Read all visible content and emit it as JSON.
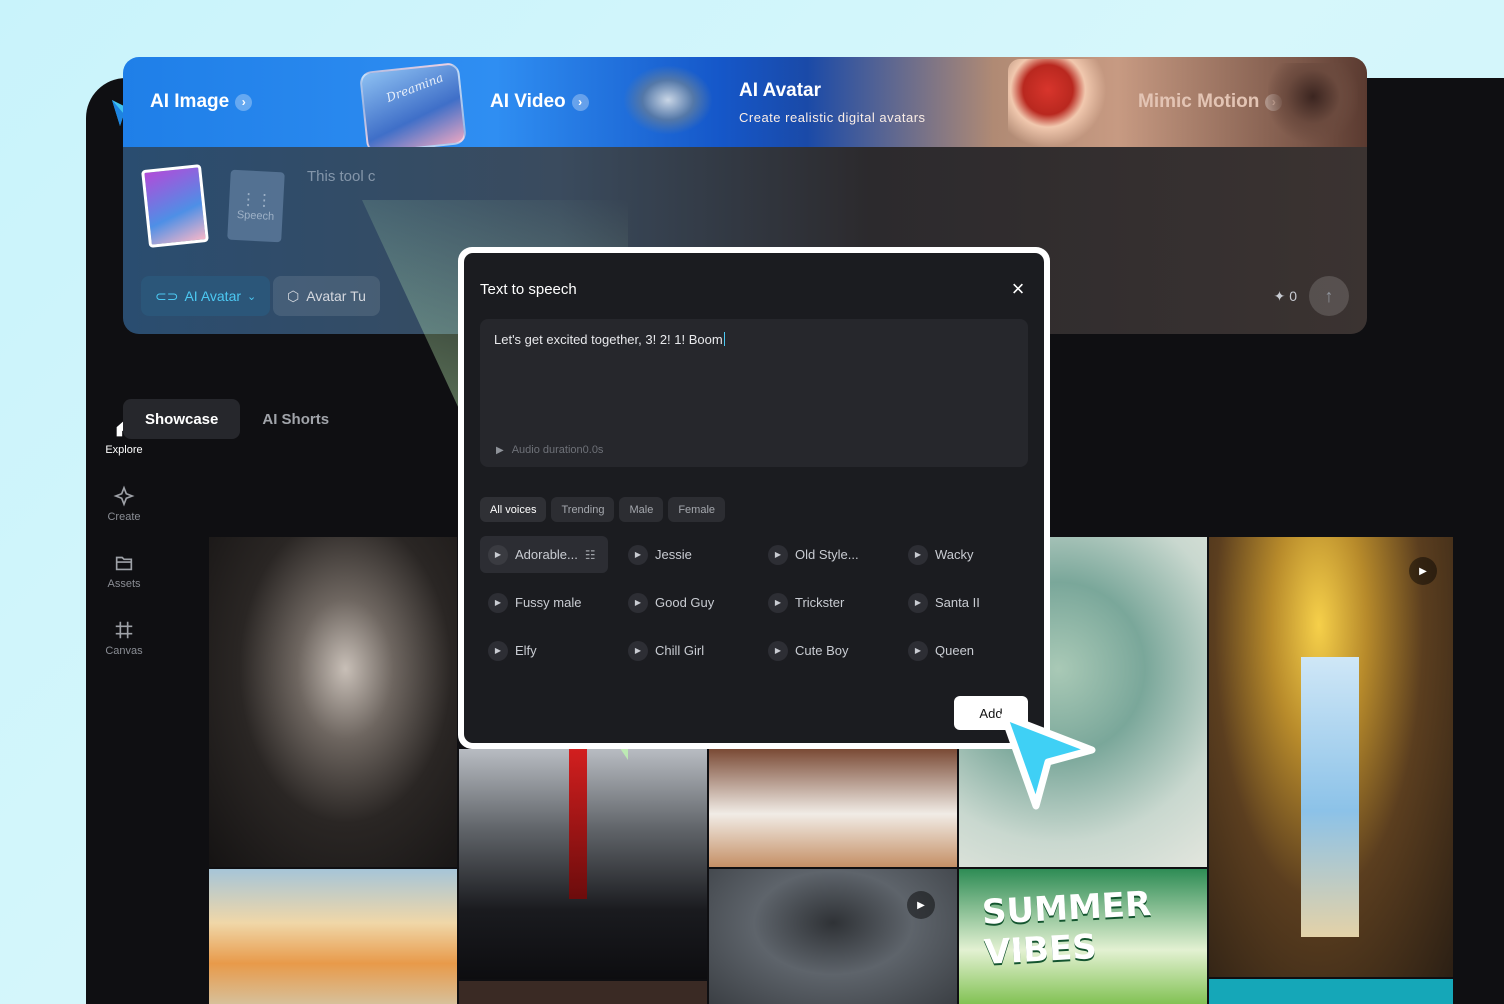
{
  "sidebar": {
    "items": [
      {
        "label": "Explore",
        "icon": "home-icon",
        "active": true
      },
      {
        "label": "Create",
        "icon": "sparkle-icon",
        "active": false
      },
      {
        "label": "Assets",
        "icon": "folder-icon",
        "active": false
      },
      {
        "label": "Canvas",
        "icon": "grid-icon",
        "active": false
      }
    ]
  },
  "banner": {
    "ai_image": "AI Image",
    "ai_video": "AI Video",
    "ai_avatar": "AI Avatar",
    "ai_avatar_sub": "Create realistic digital avatars",
    "mimic_motion": "Mimic Motion",
    "video_thumb_text": "Dreamina"
  },
  "composer": {
    "hint": "This tool c",
    "speech_card_label": "Speech",
    "avatar_pill": "AI Avatar",
    "tutorial_pill": "Avatar Tu",
    "credits": "0"
  },
  "tabs": [
    "Showcase",
    "AI Shorts"
  ],
  "gallery": {
    "summer_text": "SUMMER VIBES"
  },
  "dialog": {
    "title": "Text to speech",
    "text_value": "Let's get excited together, 3! 2! 1!  Boom",
    "audio_duration": "Audio duration0.0s",
    "filters": [
      "All voices",
      "Trending",
      "Male",
      "Female"
    ],
    "voices": [
      "Adorable...",
      "Jessie",
      "Old Style...",
      "Wacky",
      "Fussy male",
      "Good Guy",
      "Trickster",
      "Santa II",
      "Elfy",
      "Chill Girl",
      "Cute Boy",
      "Queen"
    ],
    "add_label": "Add"
  },
  "colors": {
    "accent": "#4cc8f2",
    "app_bg": "#0f0f12",
    "page_bg": "#cdf3fa"
  }
}
